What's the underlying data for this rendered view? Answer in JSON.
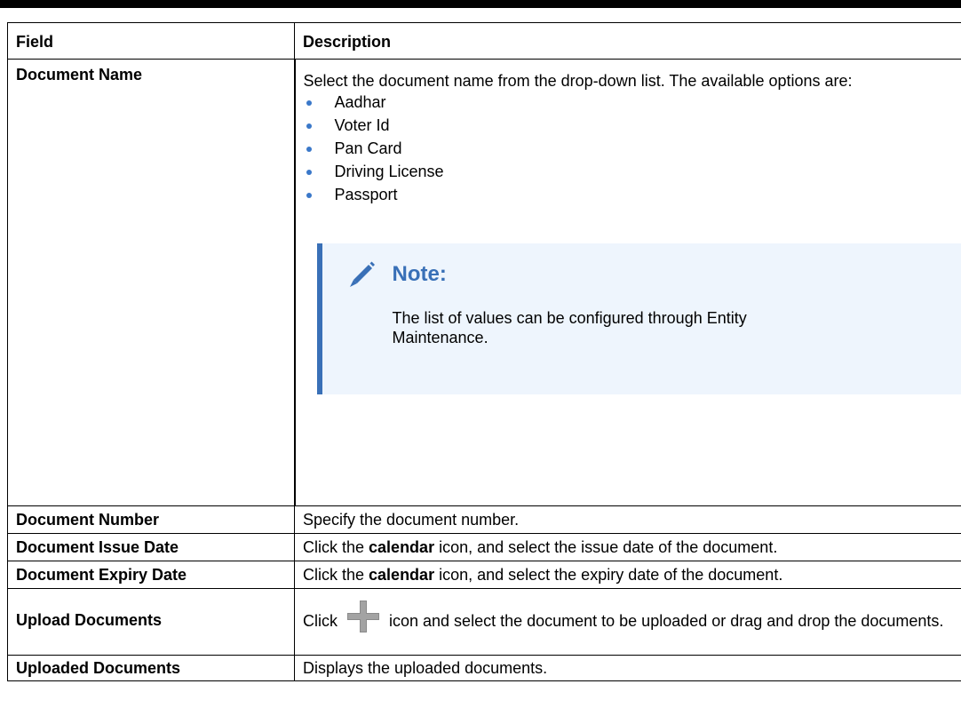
{
  "table": {
    "header": {
      "field": "Field",
      "description": "Description"
    },
    "rows": [
      {
        "field": "Document Name",
        "intro": "Select the document name from the drop-down list. The available options are:",
        "options": [
          "Aadhar",
          "Voter Id",
          "Pan Card",
          "Driving License",
          "Passport"
        ],
        "note": {
          "icon": "pencil-icon",
          "title": "Note:",
          "text": "The list of values can be configured through Entity Maintenance."
        }
      },
      {
        "field": "Document Number",
        "description": "Specify the document number."
      },
      {
        "field": "Document Issue Date",
        "desc_pre": "Click the ",
        "desc_bold": "calendar",
        "desc_post": " icon, and select the issue date of the document."
      },
      {
        "field": "Document Expiry Date",
        "desc_pre": "Click the ",
        "desc_bold": "calendar",
        "desc_post": " icon, and select the expiry date of the document."
      },
      {
        "field": "Upload Documents",
        "desc_pre": "Click ",
        "icon": "plus-icon",
        "desc_post": " icon and select the document to be uploaded or drag and drop the documents."
      },
      {
        "field": "Uploaded Documents",
        "description": "Displays the uploaded documents."
      }
    ]
  },
  "colors": {
    "accent": "#3970b7",
    "note_bg": "#eef5fd",
    "bullet": "#3a78c9"
  }
}
